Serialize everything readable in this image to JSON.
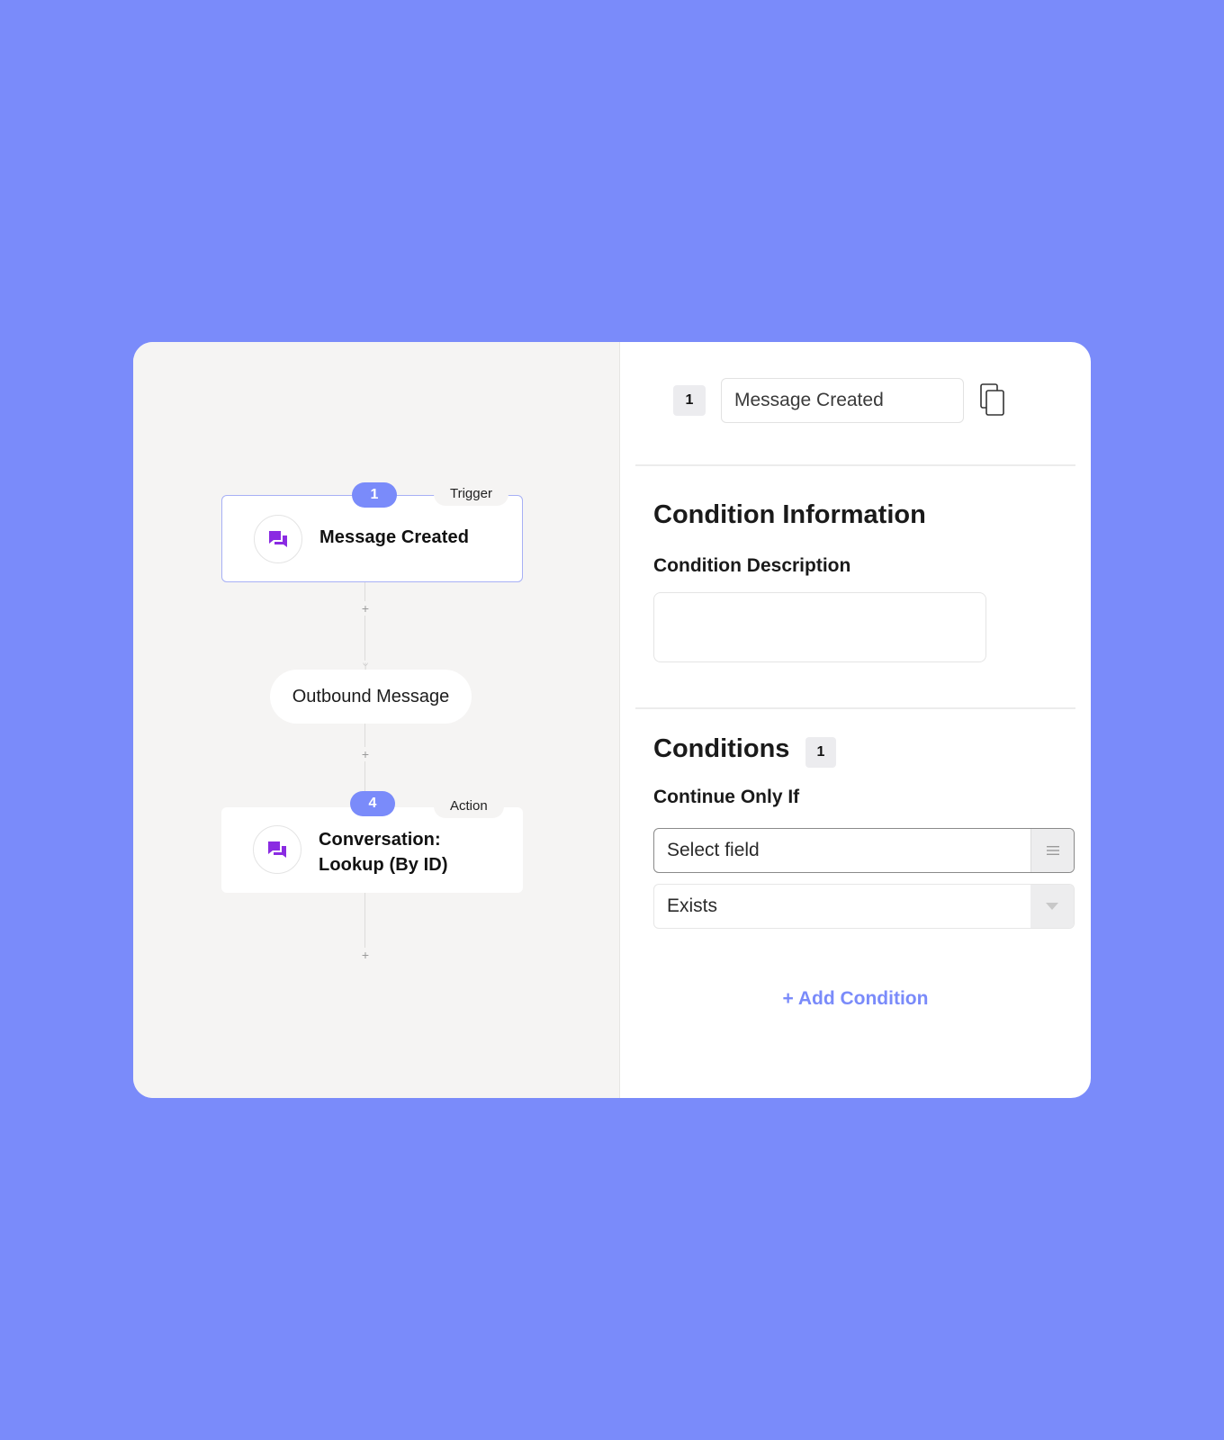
{
  "flow": {
    "trigger_node": {
      "step": "1",
      "tag": "Trigger",
      "title": "Message Created",
      "icon": "chat-bubbles-icon"
    },
    "branch_node": {
      "label": "Outbound Message",
      "icon": "branch-icon"
    },
    "action_node": {
      "step": "4",
      "tag": "Action",
      "title_line1": "Conversation:",
      "title_line2": "Lookup (By ID)",
      "icon": "chat-bubbles-icon"
    },
    "add_step_symbol": "+"
  },
  "panel": {
    "step_number": "1",
    "step_name": "Message Created",
    "copy_icon": "copy-icon",
    "condition_info_heading": "Condition Information",
    "condition_description_label": "Condition Description",
    "condition_description_value": "",
    "conditions_heading": "Conditions",
    "conditions_count": "1",
    "continue_label": "Continue Only If",
    "field_select_value": "Select field",
    "operator_select_value": "Exists",
    "add_condition_label": "+ Add Condition"
  },
  "colors": {
    "background": "#7a8bfa",
    "accent": "#7a8bfa",
    "icon_purple": "#8a2be2"
  }
}
